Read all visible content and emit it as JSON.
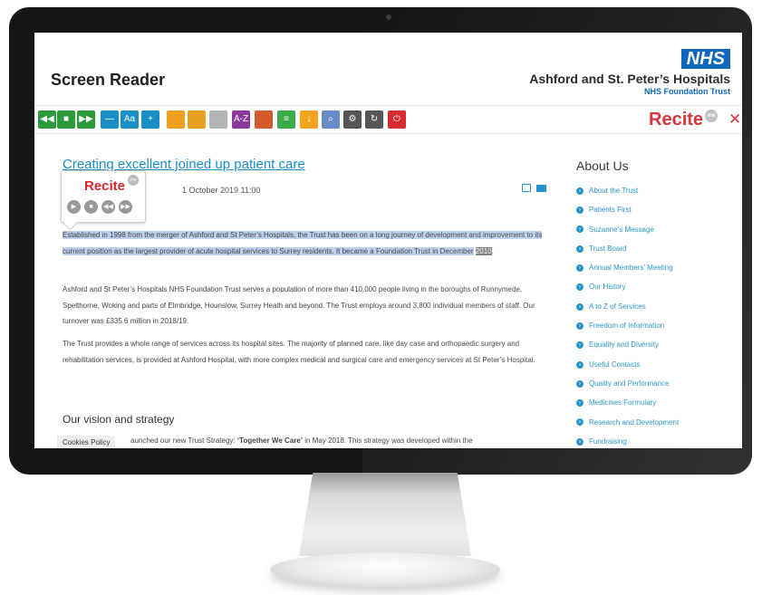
{
  "header": {
    "app_title": "Screen Reader",
    "nhs_logo": "NHS",
    "hospital_name": "Ashford and St. Peter’s Hospitals",
    "trust_subtitle": "NHS Foundation Trust"
  },
  "toolbar": {
    "font_label": "Aa",
    "reader_brand": "Recite",
    "brand_badge": "me",
    "buttons": [
      {
        "icon": "rewind-icon",
        "glyph": "◀◀",
        "color": "#2a9a3a"
      },
      {
        "icon": "stop-icon",
        "glyph": "■",
        "color": "#2a9a3a"
      },
      {
        "icon": "forward-icon",
        "glyph": "▶▶",
        "color": "#2a9a3a"
      },
      {
        "icon": "decrease-text-icon",
        "glyph": "—",
        "color": "#1a8fc7"
      },
      {
        "icon": "font-icon",
        "glyph": "Aa",
        "color": "#1a8fc7"
      },
      {
        "icon": "increase-text-icon",
        "glyph": "+",
        "color": "#1a8fc7"
      },
      {
        "icon": "color-wheel-icon",
        "glyph": "",
        "color": "#f0a020"
      },
      {
        "icon": "ruler-icon",
        "glyph": "",
        "color": "#e8a020"
      },
      {
        "icon": "reading-mask-icon",
        "glyph": "",
        "color": "#b5b5b5"
      },
      {
        "icon": "dictionary-icon",
        "glyph": "A-Z",
        "color": "#8e3a9c"
      },
      {
        "icon": "translate-icon",
        "glyph": "",
        "color": "#d35a2a"
      },
      {
        "icon": "text-only-icon",
        "glyph": "≡",
        "color": "#3aaa4a"
      },
      {
        "icon": "download-icon",
        "glyph": "↓",
        "color": "#f2a51c"
      },
      {
        "icon": "magnifier-icon",
        "glyph": "⌕",
        "color": "#6a8cc7"
      },
      {
        "icon": "settings-icon",
        "glyph": "⚙",
        "color": "#555555"
      },
      {
        "icon": "reset-icon",
        "glyph": "↻",
        "color": "#555555"
      },
      {
        "icon": "exit-icon",
        "glyph": "⏻",
        "color": "#d6282d"
      }
    ]
  },
  "article": {
    "title": "Creating excellent joined up patient care",
    "date_fragment": "1 October 2019 11:00",
    "para1_highlighted": "Established in 1998 from the merger of Ashford and St Peter’s Hospitals, the Trust has been on a long journey of development and improvement to its current position as the largest provider of acute hospital services to Surrey residents. It became a Foundation Trust in December",
    "para1_current_word": "2010",
    "para1_end": ".",
    "para2": "Ashford and St Peter’s Hospitals NHS Foundation Trust serves a population of more than 410,000 people living in the boroughs of Runnymede, Spelthorne, Woking and parts of Elmbridge, Hounslow, Surrey Heath and beyond. The Trust employs around 3,800 individual members of staff. Our turnover was £335.6 million in 2018/19.",
    "para3": "The Trust provides a whole range of services across its hospital sites. The majority of planned care, like day case and orthopaedic surgery and rehabilitation services, is provided at Ashford Hospital, with more complex medical and surgical care and emergency services at St Peter’s Hospital.",
    "section_heading": "Our vision and strategy",
    "vision_start": "aunched our new Trust Strategy: ",
    "vision_bold": "‘Together We Care’",
    "vision_end": " in May 2018. This strategy was developed within the"
  },
  "popup": {
    "brand": "Recite",
    "badge": "me",
    "controls": [
      "play-icon",
      "stop-icon",
      "rewind-icon",
      "forward-icon"
    ]
  },
  "cookies": {
    "label": "Cookies Policy"
  },
  "sidebar": {
    "title": "About Us",
    "items": [
      "About the Trust",
      "Patients First",
      "Suzanne’s Message",
      "Trust Board",
      "Annual Members’ Meeting",
      "Our History",
      "A to Z of Services",
      "Freedom of Information",
      "Equality and Diversity",
      "Useful Contacts",
      "Quality and Performance",
      "Medicines Formulary",
      "Research and Development",
      "Fundraising"
    ]
  }
}
